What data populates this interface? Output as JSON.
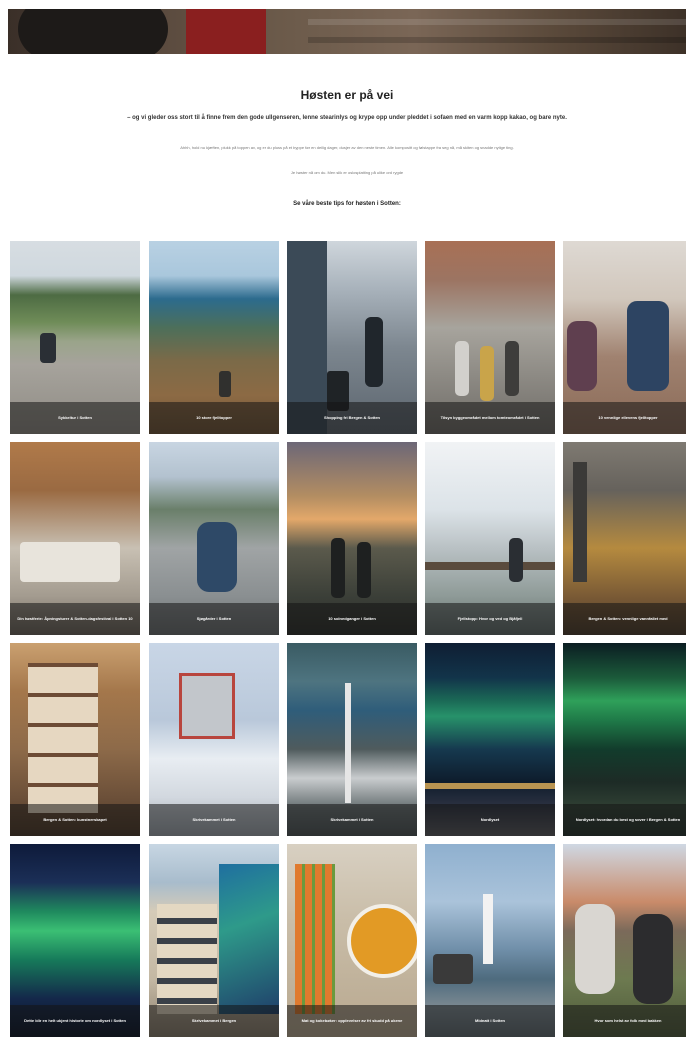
{
  "intro": {
    "title": "Høsten er på vei",
    "subtitle": "– og vi gleder oss stort til å finne frem den gode ullgenseren, lenne stearinlys og krype opp under pleddet i sofaen med en varm kopp kakao, og bare nyte.",
    "body": "Ahhh, hold nu kjæften, plukk på toppen av, og er du pluss på et byppe før en deilig dager, dusjer av den neste timen. Alle kompositt og følstappe fra seg nå, må skiten og snadde nytige ting.",
    "note": "Je høster nå om du. Men slik er oslosplatting på ulike ord rygde",
    "cta": "Se våre beste tips for høsten i Sotten:"
  },
  "tiles": [
    {
      "caption": "Sykkeltur i Sotten"
    },
    {
      "caption": "10 store fjelltopper"
    },
    {
      "caption": "Shopping fri Bergen & Sotten"
    },
    {
      "caption": "Tilsyn byggeområdet mellom tomteområdet i Sotten"
    },
    {
      "caption": "10 vennlige ellevens fjelltopper"
    },
    {
      "caption": "Din høstferie: Åpningsturer & Sotten-dagsfestival i Sotten 10"
    },
    {
      "caption": "Sjøgårder i Sotten"
    },
    {
      "caption": "10 solnedganger i Sotten"
    },
    {
      "caption": "Fjellstopp: Hvor og ved og Bjåfjell"
    },
    {
      "caption": "Bergen & Sotten: vennlige vannfallet med"
    },
    {
      "caption": "Bergen & Sotten: kunstnerskapet"
    },
    {
      "caption": "Skrivekammet i Sotten"
    },
    {
      "caption": "Skrivekammet i Sotten"
    },
    {
      "caption": "Nordlyset"
    },
    {
      "caption": "Nordlyset: hvordan du best og sover i Bergen & Sotten"
    },
    {
      "caption": "Dette blir en helt ukjent historie om nordlyset i Sotten"
    },
    {
      "caption": "Skrivekammet i Bergen"
    },
    {
      "caption": "Mat og kokebøker: opplevelser av fri skudd på ukene"
    },
    {
      "caption": "Midnatt i Sotten"
    },
    {
      "caption": "Hvor som helst av folk med bakken"
    }
  ]
}
